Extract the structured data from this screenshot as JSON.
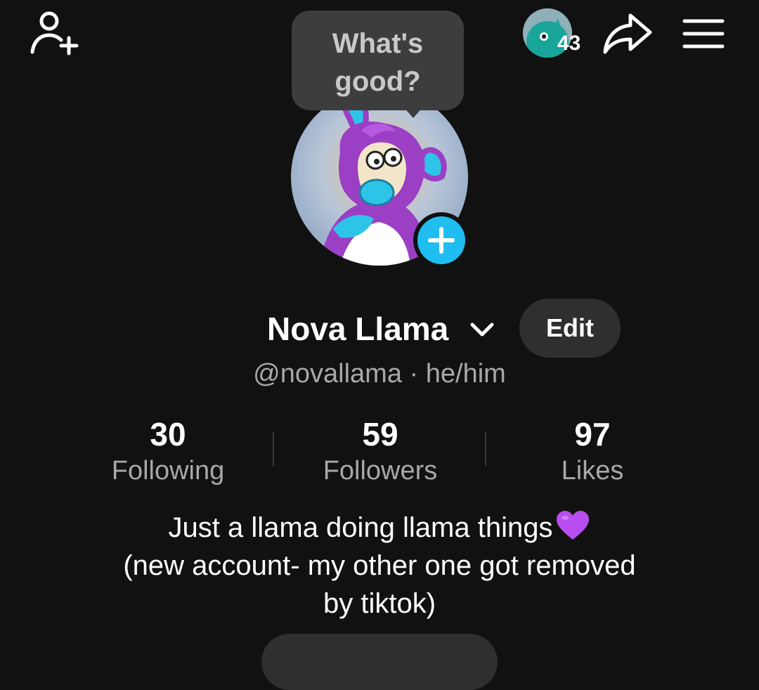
{
  "header": {
    "add_friend_icon": "person-add-icon",
    "story_count": "43",
    "share_icon": "share-arrow-icon",
    "menu_icon": "hamburger-menu-icon"
  },
  "status_bubble": {
    "line1": "What's",
    "line2": "good?"
  },
  "profile": {
    "display_name": "Nova Llama",
    "edit_label": "Edit",
    "handle": "@novallama",
    "separator": "·",
    "pronouns": "he/him",
    "add_photo_icon": "plus-icon"
  },
  "stats": [
    {
      "count": "30",
      "label": "Following"
    },
    {
      "count": "59",
      "label": "Followers"
    },
    {
      "count": "97",
      "label": "Likes"
    }
  ],
  "bio": {
    "line1": "Just a llama doing llama things",
    "line2": "(new account- my other one got removed",
    "line3": "by tiktok)",
    "emoji": "purple-heart-icon"
  },
  "colors": {
    "background": "#111111",
    "accent": "#20bdf0",
    "muted_text": "#a8a8a8",
    "button_bg": "#2f2f2f",
    "bubble_bg": "#3d3d3d",
    "heart": "#b84ef0"
  }
}
